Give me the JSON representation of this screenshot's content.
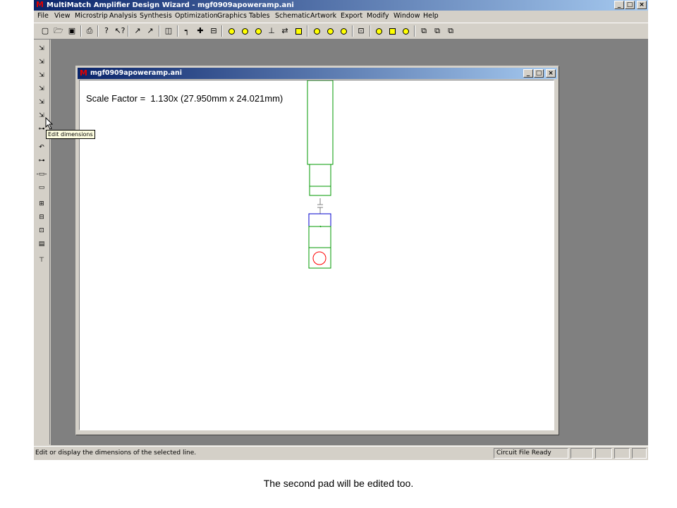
{
  "app": {
    "title": "MultiMatch Amplifier Design Wizard - mgf0909apoweramp.ani",
    "logo": "M",
    "window_buttons": {
      "minimize": "_",
      "maximize": "□",
      "close": "×"
    }
  },
  "menu": [
    "File",
    "View",
    "Microstrip",
    "Analysis",
    "Synthesis",
    "Optimization",
    "Graphics",
    "Tables",
    "Schematic",
    "Artwork",
    "Export",
    "Modify",
    "Window",
    "Help"
  ],
  "child_window": {
    "title": "mgf0909apoweramp.ani",
    "scale_factor_text": "Scale Factor =  1.130x (27.950mm x 24.021mm)"
  },
  "tooltip": "Edit dimensions",
  "status": {
    "message": "Edit or display the dimensions of the selected line.",
    "file_state": "Circuit File Ready"
  },
  "caption": "The second pad will be edited too.",
  "colors": {
    "line": "#009900",
    "selected": "#0000cc",
    "via": "#ff0000",
    "titlebar": "#0a246a"
  }
}
